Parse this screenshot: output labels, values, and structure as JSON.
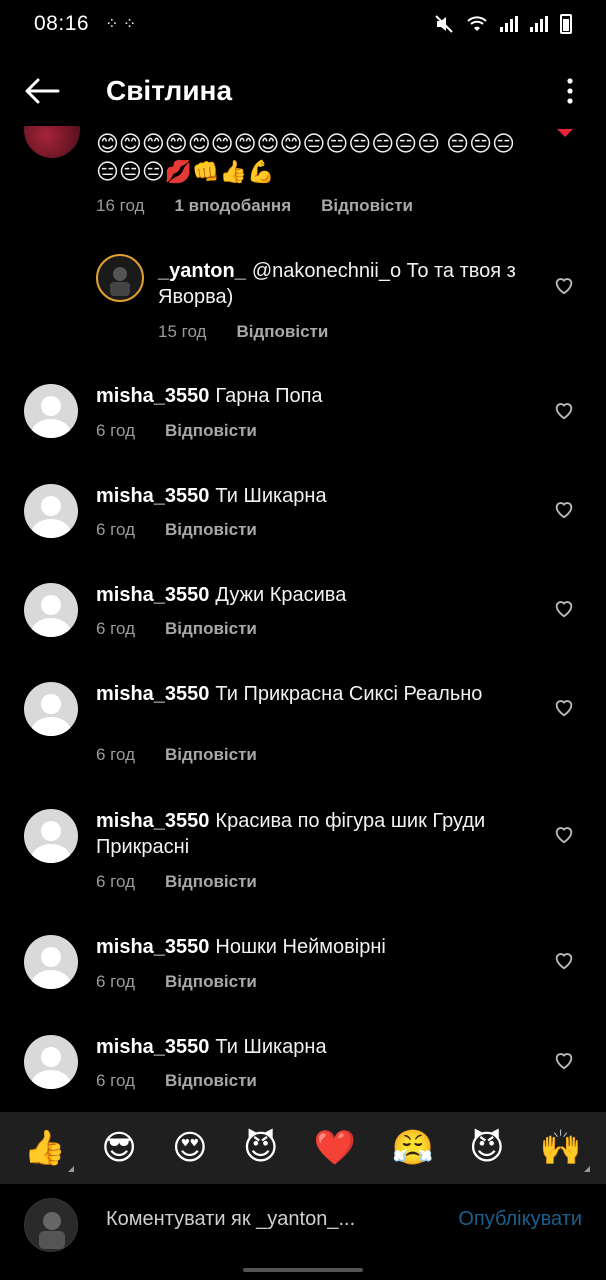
{
  "status_bar": {
    "time": "08:16",
    "left_icons": "⁘ ⁘",
    "battery_level": 0.8
  },
  "header": {
    "title": "Світлина"
  },
  "comments": [
    {
      "kind": "parent",
      "username": "",
      "text": "😊😊😊😊😊😊😊😊😊😑😑😑😑😑😑 😑😑😑😑😑😑💋👊👍💪",
      "time": "16 год",
      "likes": "1 вподобання",
      "reply": "Відповісти"
    },
    {
      "kind": "reply",
      "username": "_yanton_",
      "text": "@nakonechnii_o То та твоя з Яворва)",
      "time": "15 год",
      "reply": "Відповісти"
    },
    {
      "kind": "comment",
      "username": "misha_3550",
      "text": "Гарна Попа",
      "time": "6 год",
      "reply": "Відповісти"
    },
    {
      "kind": "comment",
      "username": "misha_3550",
      "text": "Ти Шикарна",
      "time": "6 год",
      "reply": "Відповісти"
    },
    {
      "kind": "comment",
      "username": "misha_3550",
      "text": "Дужи Красива",
      "time": "6 год",
      "reply": "Відповісти"
    },
    {
      "kind": "comment",
      "username": "misha_3550",
      "text": "Ти Прикрасна Сиксі Реально",
      "time": "6 год",
      "reply": "Відповісти"
    },
    {
      "kind": "comment",
      "username": "misha_3550",
      "text": "Красива по фігура шик Груди Прикрасні",
      "time": "6 год",
      "reply": "Відповісти"
    },
    {
      "kind": "comment",
      "username": "misha_3550",
      "text": "Ношки Неймовірні",
      "time": "6 год",
      "reply": "Відповісти"
    },
    {
      "kind": "comment",
      "username": "misha_3550",
      "text": "Ти Шикарна",
      "time": "6 год",
      "reply": "Відповісти"
    }
  ],
  "emoji_bar": [
    "👍",
    "😎",
    "😍",
    "😈",
    "❤️",
    "😤",
    "😈",
    "🙌"
  ],
  "compose": {
    "placeholder": "Коментувати як _yanton_...",
    "publish_label": "Опублікувати"
  },
  "colors": {
    "background": "#000000",
    "link": "#1c5f8c",
    "muted": "#9a9a9a",
    "emoji_bar_bg": "#1f1f1f"
  }
}
